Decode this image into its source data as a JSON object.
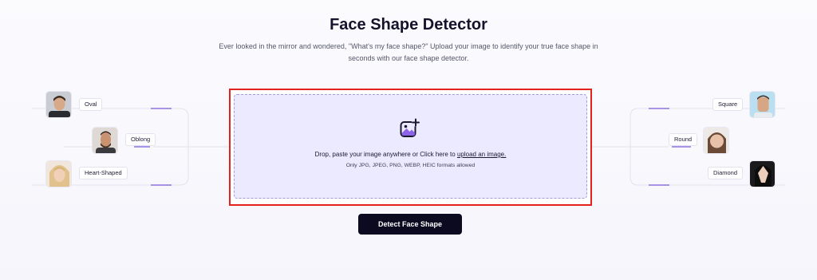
{
  "header": {
    "title": "Face Shape Detector",
    "subtitle_line1": "Ever looked in the mirror and wondered, \"What's my face shape?\" Upload your image to identify your true face shape in",
    "subtitle_line2": "seconds with our face shape detector."
  },
  "face_shapes": {
    "left": [
      {
        "label": "Oval"
      },
      {
        "label": "Oblong"
      },
      {
        "label": "Heart-Shaped"
      }
    ],
    "right": [
      {
        "label": "Square"
      },
      {
        "label": "Round"
      },
      {
        "label": "Diamond"
      }
    ]
  },
  "upload": {
    "icon": "add-image-icon",
    "text_prefix": "Drop, paste your image anywhere or Click here to",
    "link_text": "upload an image.",
    "formats_note": "Only JPG, JPEG, PNG, WEBP, HEIC formats allowed"
  },
  "actions": {
    "detect_label": "Detect Face Shape"
  },
  "colors": {
    "accent": "#7b5cd6",
    "highlight_border": "#e5211d",
    "button_bg": "#0c0a20",
    "dropzone_bg": "#eceaff"
  }
}
